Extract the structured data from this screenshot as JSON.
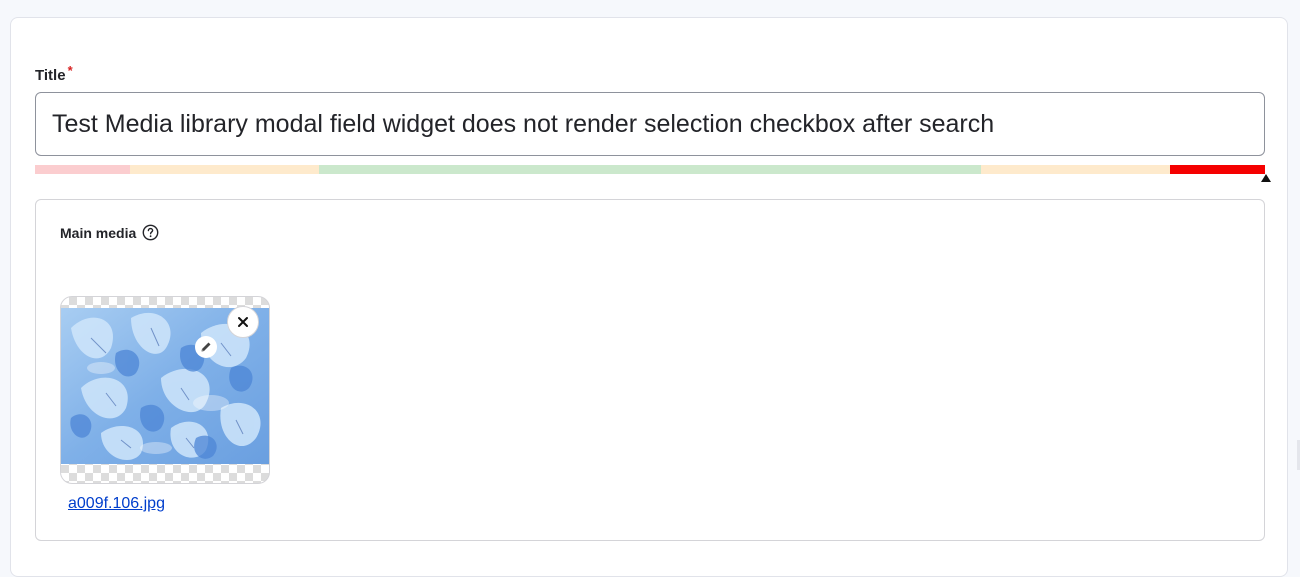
{
  "title_field": {
    "label": "Title",
    "required_marker": "*",
    "value": "Test Media library modal field widget does not render selection checkbox after search"
  },
  "length_meter": {
    "segments": [
      {
        "color": "#fbcdcf",
        "state": "too-short"
      },
      {
        "color": "#feeacc",
        "state": "short"
      },
      {
        "color": "#cbe8cc",
        "state": "good"
      },
      {
        "color": "#feeacc",
        "state": "long"
      },
      {
        "color": "#f50000",
        "state": "too-long"
      }
    ],
    "current_level": 1.0
  },
  "media_field": {
    "label": "Main media",
    "help_icon": "question-circle-icon",
    "items": [
      {
        "filename": "a009f.106.jpg",
        "remove_icon": "close-icon",
        "edit_icon": "pencil-icon"
      }
    ]
  },
  "colors": {
    "link": "#003ecc",
    "required": "#d72222",
    "accent_bad": "#f50000"
  }
}
